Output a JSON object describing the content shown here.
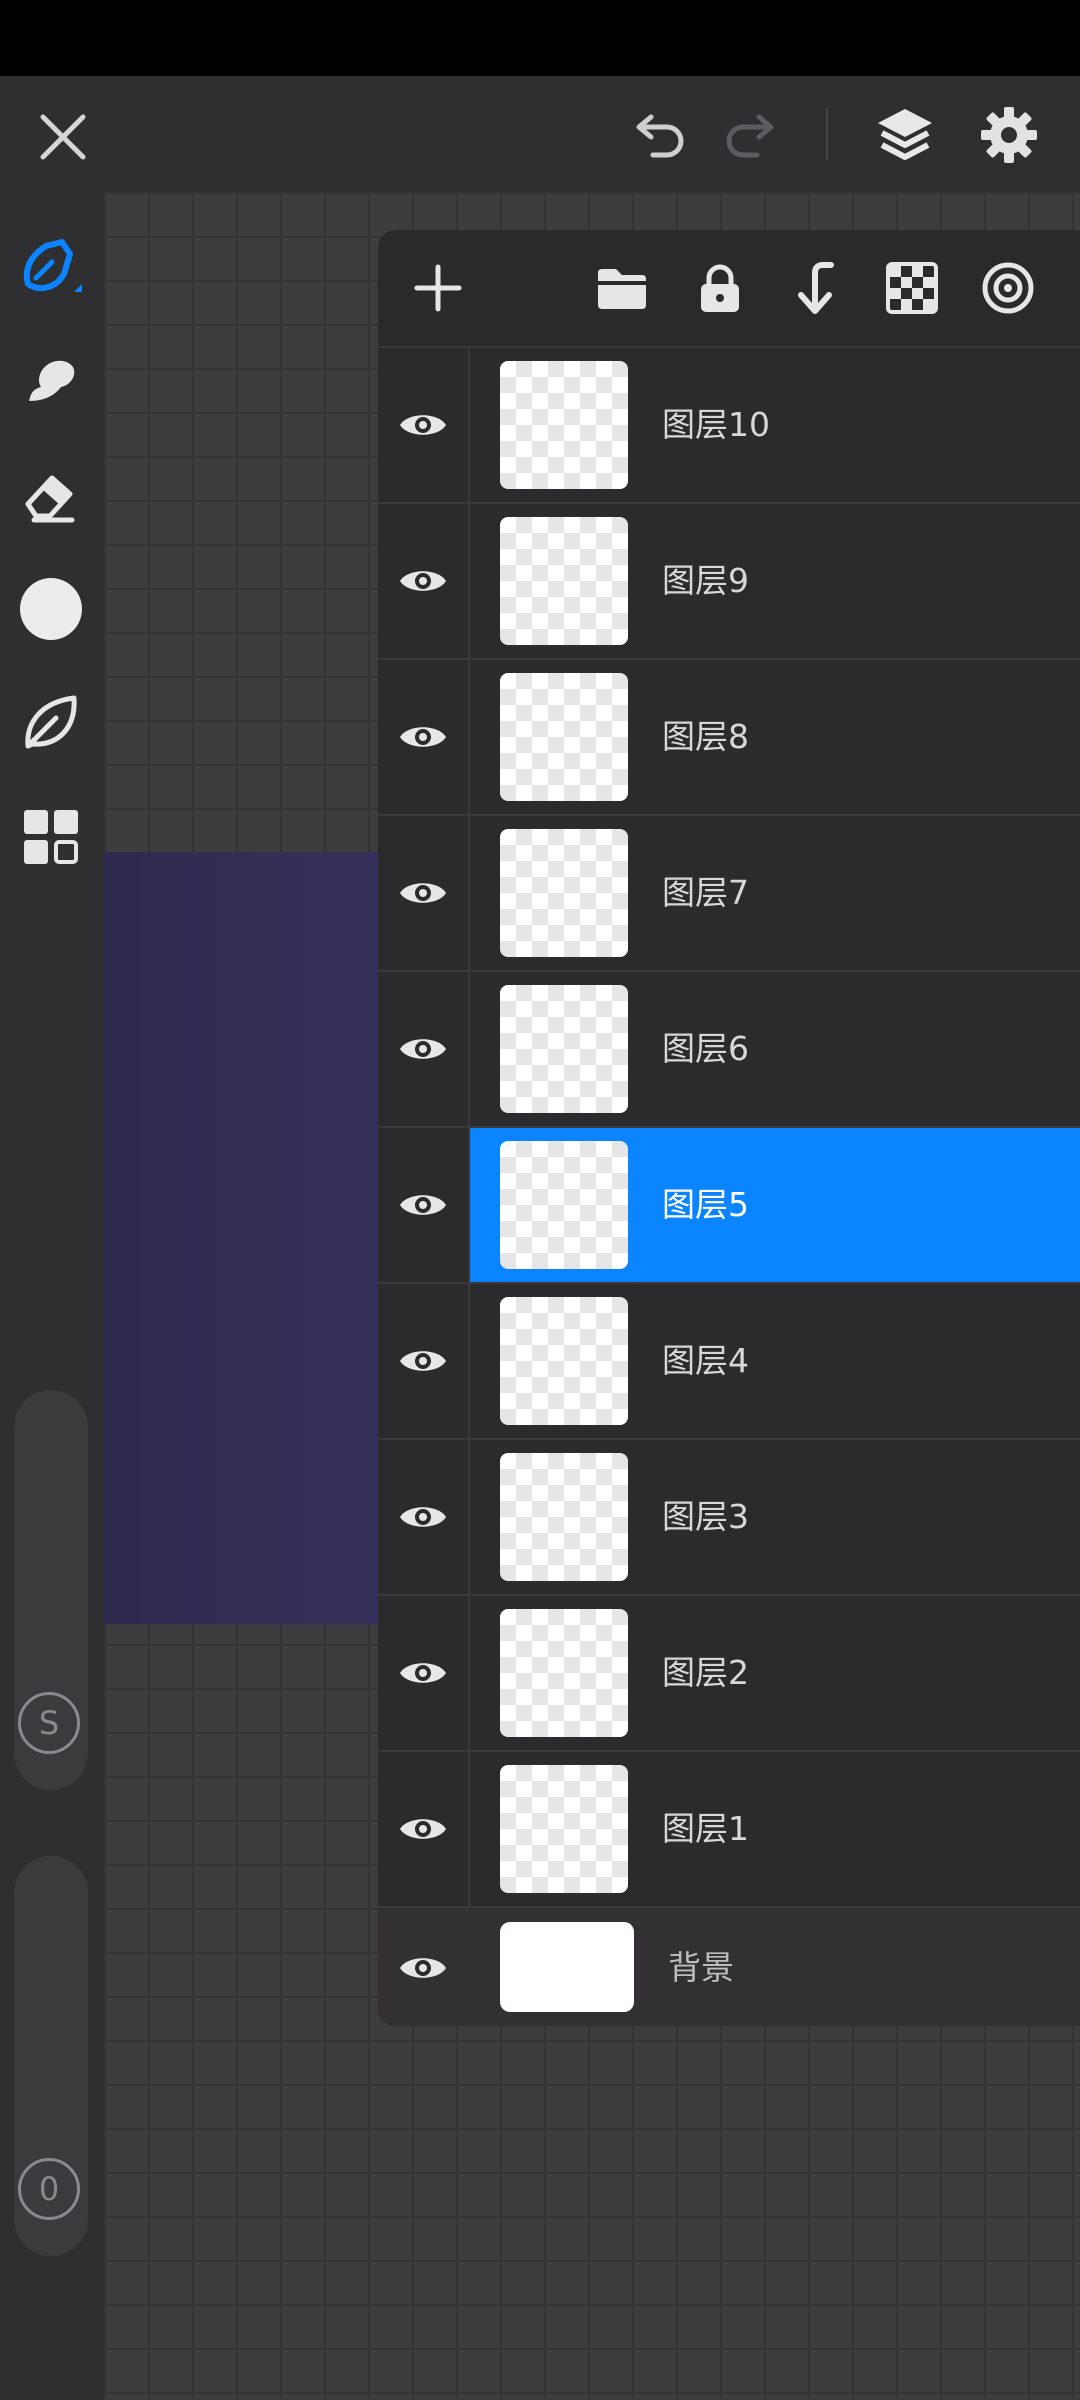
{
  "colors": {
    "accent": "#0a84ff",
    "toolbar_bg": "#2f2f31",
    "panel_bg": "#2b2a2c",
    "artwork_bg": "#332e58"
  },
  "topbar": {
    "close_icon": "close-icon",
    "undo_icon": "undo-icon",
    "redo_icon": "redo-icon",
    "layers_icon": "layers-icon",
    "settings_icon": "gear-icon"
  },
  "tools": [
    "brush-tool",
    "smudge-tool",
    "eraser-tool",
    "color-picker",
    "leaf-tool",
    "grid-menu"
  ],
  "sliders": {
    "size_label": "S",
    "opacity_label": "0"
  },
  "layers_toolbar": [
    "add-icon",
    "folder-icon",
    "lock-icon",
    "merge-down-icon",
    "checker-icon",
    "target-icon"
  ],
  "layers": [
    {
      "name": "图层10",
      "visible": true,
      "selected": false
    },
    {
      "name": "图层9",
      "visible": true,
      "selected": false
    },
    {
      "name": "图层8",
      "visible": true,
      "selected": false
    },
    {
      "name": "图层7",
      "visible": true,
      "selected": false
    },
    {
      "name": "图层6",
      "visible": true,
      "selected": false
    },
    {
      "name": "图层5",
      "visible": true,
      "selected": true
    },
    {
      "name": "图层4",
      "visible": true,
      "selected": false
    },
    {
      "name": "图层3",
      "visible": true,
      "selected": false
    },
    {
      "name": "图层2",
      "visible": true,
      "selected": false
    },
    {
      "name": "图层1",
      "visible": true,
      "selected": false
    }
  ],
  "background_layer": {
    "name": "背景",
    "visible": true
  }
}
